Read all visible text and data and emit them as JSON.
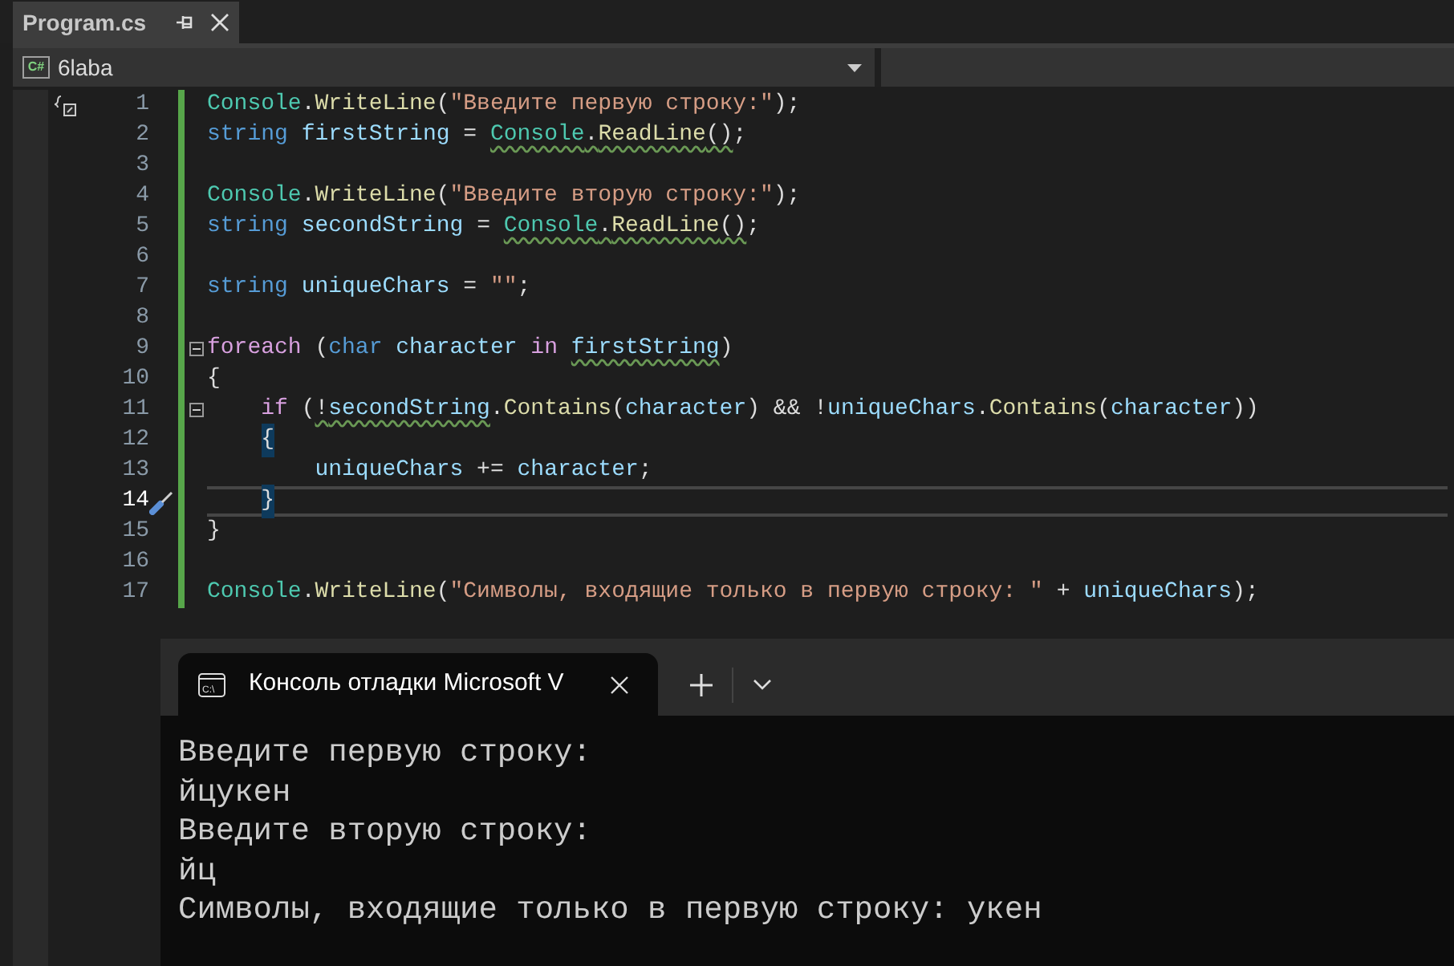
{
  "document_tab": {
    "title": "Program.cs",
    "selected": true
  },
  "navigation_bar": {
    "project_icon_label": "C#",
    "project": "6laba"
  },
  "code_lines": [
    {
      "number": "1",
      "fold": false,
      "current": false,
      "tokens": [
        {
          "kind": "type",
          "text": "Console"
        },
        {
          "kind": "plain",
          "text": "."
        },
        {
          "kind": "method",
          "text": "WriteLine"
        },
        {
          "kind": "plain",
          "text": "("
        },
        {
          "kind": "string",
          "text": "\"Введите первую строку:\""
        },
        {
          "kind": "plain",
          "text": ");"
        }
      ]
    },
    {
      "number": "2",
      "fold": false,
      "current": false,
      "tokens": [
        {
          "kind": "keyword",
          "text": "string "
        },
        {
          "kind": "variable",
          "text": "firstString"
        },
        {
          "kind": "plain",
          "text": " = "
        },
        {
          "kind": "type",
          "text": "Console",
          "squiggle": true
        },
        {
          "kind": "plain",
          "text": ".",
          "squiggle": true
        },
        {
          "kind": "method",
          "text": "ReadLine",
          "squiggle": true
        },
        {
          "kind": "plain",
          "text": "()",
          "squiggle": true
        },
        {
          "kind": "plain",
          "text": ";"
        }
      ]
    },
    {
      "number": "3",
      "fold": false,
      "current": false
    },
    {
      "number": "4",
      "fold": false,
      "current": false,
      "tokens": [
        {
          "kind": "type",
          "text": "Console"
        },
        {
          "kind": "plain",
          "text": "."
        },
        {
          "kind": "method",
          "text": "WriteLine"
        },
        {
          "kind": "plain",
          "text": "("
        },
        {
          "kind": "string",
          "text": "\"Введите вторую строку:\""
        },
        {
          "kind": "plain",
          "text": ");"
        }
      ]
    },
    {
      "number": "5",
      "fold": false,
      "current": false,
      "tokens": [
        {
          "kind": "keyword",
          "text": "string "
        },
        {
          "kind": "variable",
          "text": "secondString"
        },
        {
          "kind": "plain",
          "text": " = "
        },
        {
          "kind": "type",
          "text": "Console",
          "squiggle": true
        },
        {
          "kind": "plain",
          "text": ".",
          "squiggle": true
        },
        {
          "kind": "method",
          "text": "ReadLine",
          "squiggle": true
        },
        {
          "kind": "plain",
          "text": "()",
          "squiggle": true
        },
        {
          "kind": "plain",
          "text": ";"
        }
      ]
    },
    {
      "number": "6",
      "fold": false,
      "current": false
    },
    {
      "number": "7",
      "fold": false,
      "current": false,
      "tokens": [
        {
          "kind": "keyword",
          "text": "string "
        },
        {
          "kind": "variable",
          "text": "uniqueChars"
        },
        {
          "kind": "plain",
          "text": " = "
        },
        {
          "kind": "string",
          "text": "\"\""
        },
        {
          "kind": "plain",
          "text": ";"
        }
      ]
    },
    {
      "number": "8",
      "fold": false,
      "current": false
    },
    {
      "number": "9",
      "fold": true,
      "current": false,
      "tokens": [
        {
          "kind": "control",
          "text": "foreach"
        },
        {
          "kind": "plain",
          "text": " ("
        },
        {
          "kind": "keyword",
          "text": "char "
        },
        {
          "kind": "variable",
          "text": "character "
        },
        {
          "kind": "control",
          "text": "in "
        },
        {
          "kind": "variable",
          "text": "firstString",
          "squiggle": true
        },
        {
          "kind": "plain",
          "text": ")"
        }
      ]
    },
    {
      "number": "10",
      "fold": false,
      "current": false,
      "tokens": [
        {
          "kind": "plain",
          "text": "{"
        }
      ]
    },
    {
      "number": "11",
      "fold": true,
      "current": false,
      "tokens": [
        {
          "kind": "control",
          "text": "    if"
        },
        {
          "kind": "plain",
          "text": " ("
        },
        {
          "kind": "plain",
          "text": "!",
          "squiggle": true
        },
        {
          "kind": "variable",
          "text": "secondString",
          "squiggle": true
        },
        {
          "kind": "plain",
          "text": "."
        },
        {
          "kind": "method",
          "text": "Contains"
        },
        {
          "kind": "plain",
          "text": "("
        },
        {
          "kind": "variable",
          "text": "character"
        },
        {
          "kind": "plain",
          "text": ") && !"
        },
        {
          "kind": "variable",
          "text": "uniqueChars"
        },
        {
          "kind": "plain",
          "text": "."
        },
        {
          "kind": "method",
          "text": "Contains"
        },
        {
          "kind": "plain",
          "text": "("
        },
        {
          "kind": "variable",
          "text": "character"
        },
        {
          "kind": "plain",
          "text": "))"
        }
      ]
    },
    {
      "number": "12",
      "fold": false,
      "current": false,
      "tokens": [
        {
          "kind": "plain",
          "text": "    {",
          "highlight": true
        }
      ]
    },
    {
      "number": "13",
      "fold": false,
      "current": false,
      "tokens": [
        {
          "kind": "variable",
          "text": "        uniqueChars"
        },
        {
          "kind": "plain",
          "text": " += "
        },
        {
          "kind": "variable",
          "text": "character"
        },
        {
          "kind": "plain",
          "text": ";"
        }
      ]
    },
    {
      "number": "14",
      "fold": false,
      "current": true,
      "tokens": [
        {
          "kind": "plain",
          "text": "    }",
          "highlight": true
        }
      ]
    },
    {
      "number": "15",
      "fold": false,
      "current": false,
      "tokens": [
        {
          "kind": "plain",
          "text": "}"
        }
      ]
    },
    {
      "number": "16",
      "fold": false,
      "current": false
    },
    {
      "number": "17",
      "fold": false,
      "current": false,
      "tokens": [
        {
          "kind": "type",
          "text": "Console"
        },
        {
          "kind": "plain",
          "text": "."
        },
        {
          "kind": "method",
          "text": "WriteLine"
        },
        {
          "kind": "plain",
          "text": "("
        },
        {
          "kind": "string",
          "text": "\"Символы, входящие только в первую строку: \""
        },
        {
          "kind": "plain",
          "text": " + "
        },
        {
          "kind": "variable",
          "text": "uniqueChars"
        },
        {
          "kind": "plain",
          "text": ");"
        }
      ]
    }
  ],
  "console_window": {
    "tab_icon_label": "C:\\",
    "tab_title": "Консоль отладки Microsoft V",
    "output_lines": [
      "Введите первую строку:",
      "йцукен",
      "Введите вторую строку:",
      "йц",
      "Символы, входящие только в первую строку: укен"
    ]
  }
}
